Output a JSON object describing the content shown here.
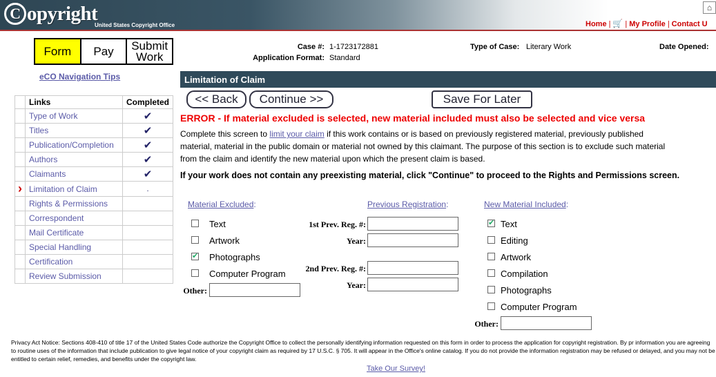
{
  "header": {
    "logo_text": "opyright",
    "logo_c": "C",
    "logo_subtitle": "United States Copyright Office",
    "nav": {
      "home": "Home",
      "my_profile": "My Profile",
      "contact": "Contact U"
    }
  },
  "steps": [
    {
      "label": "Form",
      "active": true
    },
    {
      "label": "Pay",
      "active": false
    },
    {
      "label": "Submit Work",
      "active": false
    }
  ],
  "nav_tips": "eCO Navigation Tips",
  "links_table": {
    "header_links": "Links",
    "header_completed": "Completed",
    "current_marker": "›",
    "rows": [
      {
        "label": "Type of Work",
        "completed": "✔"
      },
      {
        "label": "Titles",
        "completed": "✔"
      },
      {
        "label": "Publication/Completion",
        "completed": "✔"
      },
      {
        "label": "Authors",
        "completed": "✔"
      },
      {
        "label": "Claimants",
        "completed": "✔"
      },
      {
        "label": "Limitation of Claim",
        "completed": "."
      },
      {
        "label": "Rights & Permissions",
        "completed": ""
      },
      {
        "label": "Correspondent",
        "completed": ""
      },
      {
        "label": "Mail Certificate",
        "completed": ""
      },
      {
        "label": "Special Handling",
        "completed": ""
      },
      {
        "label": "Certification",
        "completed": ""
      },
      {
        "label": "Review Submission",
        "completed": ""
      }
    ]
  },
  "case_info": {
    "case_label": "Case #:",
    "case_value": "1-1723172881",
    "format_label": "Application Format:",
    "format_value": "Standard",
    "type_label": "Type of Case:",
    "type_value": "Literary Work",
    "date_label": "Date Opened:"
  },
  "section": {
    "title": "Limitation of Claim",
    "back_button": "<< Back",
    "continue_button": "Continue >>",
    "save_button": "Save For Later",
    "error": "ERROR - If material excluded is selected, new material included must also be selected and vice versa",
    "intro_before": "Complete this screen to ",
    "intro_link": "limit your claim",
    "intro_after": " if this work contains or is based on previously registered material, previously published material, material in the public domain or material not owned by this claimant. The purpose of this section is to exclude such material from the claim and identify the new material upon which the present claim is based.",
    "notice": "If your work does not contain any preexisting material, click \"Continue\" to proceed to the Rights and Permissions screen."
  },
  "material_excluded": {
    "heading": "Material Excluded",
    "items": [
      {
        "label": "Text",
        "checked": false
      },
      {
        "label": "Artwork",
        "checked": false
      },
      {
        "label": "Photographs",
        "checked": true
      },
      {
        "label": "Computer Program",
        "checked": false
      }
    ],
    "other_label": "Other:",
    "other_value": ""
  },
  "previous_registration": {
    "heading": "Previous Registration",
    "first_label": "1st Prev. Reg. #:",
    "first_value": "",
    "year_label": "Year:",
    "first_year_value": "",
    "second_label": "2nd Prev. Reg. #:",
    "second_value": "",
    "second_year_value": ""
  },
  "new_material": {
    "heading": "New Material Included",
    "items": [
      {
        "label": "Text",
        "checked": true
      },
      {
        "label": "Editing",
        "checked": false
      },
      {
        "label": "Artwork",
        "checked": false
      },
      {
        "label": "Compilation",
        "checked": false
      },
      {
        "label": "Photographs",
        "checked": false
      },
      {
        "label": "Computer Program",
        "checked": false
      }
    ],
    "other_label": "Other:",
    "other_value": ""
  },
  "footer": {
    "privacy": "Privacy Act Notice: Sections 408-410 of title 17 of the United States Code authorize the Copyright Office to collect the personally identifying information requested on this form in order to process the application for copyright registration. By pr information you are agreeing to routine uses of the information that include publication to give legal notice of your copyright claim as required by 17 U.S.C. § 705. It will appear in the Office's online catalog. If you do not provide the information registration may be refused or delayed, and you may not be entitled to certain relief, remedies, and benefits under the copyright law.",
    "survey": "Take Our Survey!"
  }
}
